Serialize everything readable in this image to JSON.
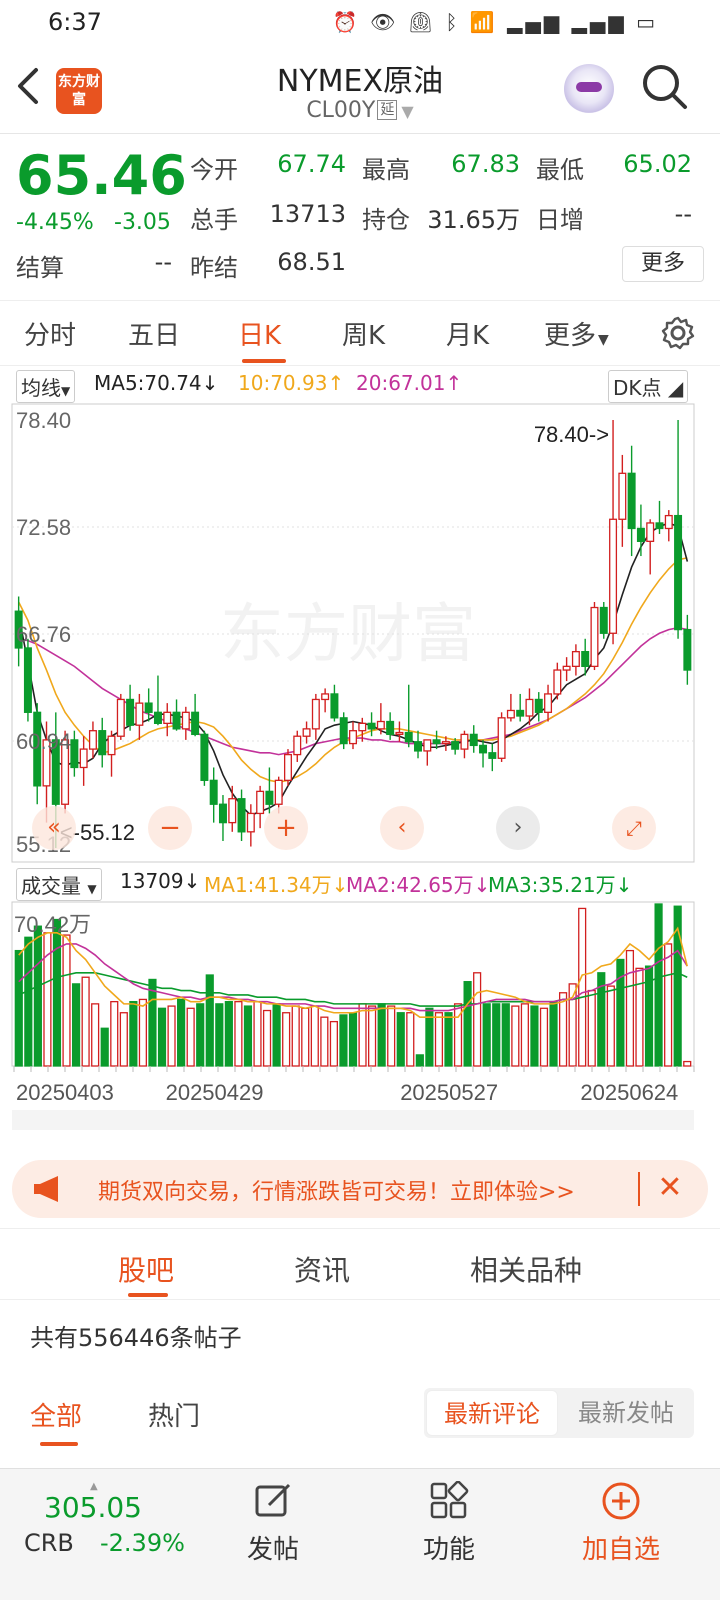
{
  "status_bar": {
    "time": "6:37",
    "icons": [
      "alarm-icon",
      "eye-icon",
      "clock-icon",
      "bluetooth-icon",
      "wifi-icon",
      "signal-4g-icon",
      "signal-4g-icon",
      "battery-icon"
    ]
  },
  "header": {
    "logo_text": "东方财富",
    "title": "NYMEX原油",
    "code": "CL00Y",
    "code_tag": "延"
  },
  "quote": {
    "price": "65.46",
    "change_pct": "-4.45%",
    "change": "-3.05",
    "open_label": "今开",
    "open": "67.74",
    "high_label": "最高",
    "high": "67.83",
    "low_label": "最低",
    "low": "65.02",
    "volume_label": "总手",
    "volume": "13713",
    "oi_label": "持仓",
    "oi": "31.65万",
    "daily_inc_label": "日增",
    "daily_inc": "--",
    "settle_label": "结算",
    "settle": "--",
    "prev_settle_label": "昨结",
    "prev_settle": "68.51",
    "more_label": "更多"
  },
  "period_tabs": [
    "分时",
    "五日",
    "日K",
    "周K",
    "月K",
    "更多"
  ],
  "active_period_tab": 2,
  "chart_legend": {
    "selector": "均线",
    "ma5": "MA5:70.74↓",
    "ma10": "10:70.93↑",
    "ma20": "20:67.01↑",
    "dk_label": "DK点",
    "vol_selector": "成交量",
    "vol_value": "13709↓",
    "vol_ma1": "MA1:41.34万↓",
    "vol_ma2": "MA2:42.65万↓",
    "vol_ma3": "MA3:35.21万↓"
  },
  "chart_data": [
    {
      "type": "candlestick",
      "y_ticks": [
        "78.40",
        "72.58",
        "66.76",
        "60.94",
        "55.12"
      ],
      "ylim": [
        55.12,
        78.4
      ],
      "annotations": {
        "high_label": "78.40->",
        "low_label": "<-55.12"
      },
      "watermark": "东方财富",
      "x_ticks": [
        "20250403",
        "20250429",
        "20250527",
        "20250624"
      ],
      "candles": [
        [
          68.0,
          68.8,
          65.0,
          66.0
        ],
        [
          66.0,
          66.5,
          62.0,
          62.5
        ],
        [
          62.5,
          63.0,
          57.5,
          58.5
        ],
        [
          58.5,
          62.0,
          56.5,
          61.0
        ],
        [
          61.0,
          62.5,
          55.12,
          57.5
        ],
        [
          57.5,
          61.5,
          57.0,
          61.0
        ],
        [
          61.0,
          61.5,
          59.0,
          59.5
        ],
        [
          59.5,
          61.2,
          58.5,
          60.5
        ],
        [
          60.5,
          62.0,
          60.0,
          61.5
        ],
        [
          61.5,
          62.2,
          59.5,
          60.2
        ],
        [
          60.2,
          61.5,
          59.0,
          61.2
        ],
        [
          61.2,
          63.5,
          61.0,
          63.2
        ],
        [
          63.2,
          64.0,
          61.5,
          61.8
        ],
        [
          61.8,
          63.5,
          61.0,
          63.0
        ],
        [
          63.0,
          63.8,
          62.0,
          62.5
        ],
        [
          62.5,
          64.5,
          61.8,
          61.9
        ],
        [
          61.9,
          63.0,
          61.2,
          62.5
        ],
        [
          62.5,
          63.2,
          61.5,
          61.6
        ],
        [
          61.6,
          62.8,
          61.0,
          62.5
        ],
        [
          62.5,
          63.5,
          61.2,
          61.3
        ],
        [
          61.3,
          61.5,
          58.5,
          58.8
        ],
        [
          58.8,
          59.5,
          56.5,
          57.5
        ],
        [
          57.5,
          58.0,
          55.5,
          56.5
        ],
        [
          56.5,
          58.5,
          56.0,
          57.8
        ],
        [
          57.8,
          58.3,
          55.5,
          56.0
        ],
        [
          56.0,
          57.5,
          55.2,
          57.0
        ],
        [
          57.0,
          58.5,
          56.2,
          58.2
        ],
        [
          58.2,
          59.5,
          57.0,
          57.5
        ],
        [
          57.5,
          59.0,
          57.0,
          58.8
        ],
        [
          58.8,
          60.5,
          58.5,
          60.2
        ],
        [
          60.2,
          61.5,
          59.8,
          61.2
        ],
        [
          61.2,
          62.0,
          60.8,
          61.6
        ],
        [
          61.6,
          63.5,
          61.0,
          63.2
        ],
        [
          63.2,
          63.8,
          62.5,
          63.5
        ],
        [
          63.5,
          64.0,
          62.0,
          62.2
        ],
        [
          62.2,
          62.5,
          60.5,
          60.8
        ],
        [
          60.8,
          62.0,
          60.5,
          61.5
        ],
        [
          61.5,
          62.2,
          60.9,
          61.9
        ],
        [
          61.9,
          62.5,
          61.2,
          61.6
        ],
        [
          61.6,
          63.0,
          61.3,
          62.0
        ],
        [
          62.0,
          62.5,
          61.0,
          61.3
        ],
        [
          61.3,
          62.0,
          60.9,
          61.4
        ],
        [
          61.4,
          64.0,
          60.6,
          60.9
        ],
        [
          60.9,
          61.5,
          60.0,
          60.4
        ],
        [
          60.4,
          61.0,
          59.6,
          61.0
        ],
        [
          61.0,
          61.5,
          60.5,
          60.8
        ],
        [
          60.8,
          61.2,
          60.4,
          60.9
        ],
        [
          60.9,
          61.1,
          60.2,
          60.5
        ],
        [
          60.5,
          61.5,
          60.0,
          61.3
        ],
        [
          61.3,
          61.8,
          60.3,
          60.7
        ],
        [
          60.7,
          61.0,
          59.5,
          60.3
        ],
        [
          60.3,
          60.8,
          59.3,
          60.0
        ],
        [
          60.0,
          62.5,
          59.8,
          62.2
        ],
        [
          62.2,
          63.5,
          62.0,
          62.6
        ],
        [
          62.6,
          63.5,
          62.0,
          62.3
        ],
        [
          62.3,
          63.8,
          61.8,
          63.2
        ],
        [
          63.2,
          63.6,
          62.0,
          62.5
        ],
        [
          62.5,
          64.0,
          62.0,
          63.5
        ],
        [
          63.5,
          65.2,
          63.2,
          64.8
        ],
        [
          64.8,
          65.5,
          64.2,
          65.0
        ],
        [
          65.0,
          66.2,
          64.5,
          65.8
        ],
        [
          65.8,
          66.5,
          64.5,
          65.0
        ],
        [
          65.0,
          68.5,
          64.8,
          68.2
        ],
        [
          68.2,
          68.5,
          66.5,
          66.8
        ],
        [
          66.8,
          78.4,
          66.2,
          73.0
        ],
        [
          73.0,
          76.5,
          71.5,
          75.5
        ],
        [
          75.5,
          77.0,
          71.0,
          72.5
        ],
        [
          72.5,
          73.8,
          71.0,
          71.8
        ],
        [
          71.8,
          73.0,
          70.0,
          72.8
        ],
        [
          72.8,
          74.0,
          72.2,
          72.5
        ],
        [
          72.5,
          73.5,
          71.8,
          73.2
        ],
        [
          73.2,
          78.4,
          66.5,
          67.0
        ],
        [
          67.0,
          67.8,
          64.0,
          64.8
        ]
      ],
      "ma_lines": {
        "MA5_color": "#222222",
        "MA10_color": "#f0a81c",
        "MA20_color": "#c2329a",
        "MA5": [
          67.8,
          65.2,
          62.5,
          61.0,
          59.8,
          59.6,
          59.8,
          59.7,
          60.0,
          60.8,
          61.2,
          61.5,
          61.8,
          61.9,
          62.1,
          62.4,
          62.4,
          62.3,
          62.2,
          62.0,
          61.4,
          60.4,
          59.1,
          58.1,
          57.4,
          56.9,
          57.1,
          57.3,
          57.6,
          58.5,
          59.3,
          60.1,
          60.8,
          61.6,
          61.8,
          61.9,
          62.0,
          61.9,
          61.8,
          61.5,
          61.3,
          61.2,
          61.0,
          60.8,
          60.6,
          60.6,
          60.7,
          60.8,
          60.9,
          61.0,
          60.9,
          60.8,
          61.0,
          61.3,
          61.6,
          62.0,
          62.5,
          62.8,
          63.4,
          64.0,
          64.3,
          64.6,
          65.4,
          66.0,
          67.3,
          68.9,
          70.4,
          71.5,
          72.3,
          72.6,
          72.8,
          72.6,
          70.7
        ],
        "MA10": [
          68.5,
          67.5,
          66.0,
          64.8,
          63.5,
          62.5,
          61.8,
          61.2,
          60.7,
          60.3,
          60.4,
          60.6,
          60.8,
          61.1,
          61.4,
          61.6,
          61.7,
          61.8,
          61.9,
          62.0,
          61.9,
          61.7,
          61.2,
          60.6,
          59.9,
          59.4,
          59.0,
          58.8,
          58.7,
          58.8,
          59.0,
          59.3,
          59.7,
          60.2,
          60.6,
          60.9,
          61.1,
          61.3,
          61.5,
          61.6,
          61.6,
          61.6,
          61.5,
          61.4,
          61.3,
          61.2,
          61.1,
          61.0,
          61.0,
          61.0,
          61.0,
          61.0,
          61.1,
          61.2,
          61.4,
          61.6,
          61.8,
          62.1,
          62.4,
          62.7,
          63.1,
          63.5,
          64.0,
          64.6,
          65.4,
          66.3,
          67.3,
          68.2,
          69.0,
          69.7,
          70.3,
          70.8,
          70.9
        ],
        "MA20": [
          66.5,
          66.4,
          66.2,
          65.9,
          65.6,
          65.3,
          65.0,
          64.6,
          64.2,
          63.8,
          63.5,
          63.2,
          62.9,
          62.6,
          62.4,
          62.2,
          62.0,
          61.8,
          61.6,
          61.4,
          61.2,
          61.0,
          60.8,
          60.6,
          60.5,
          60.4,
          60.3,
          60.3,
          60.2,
          60.3,
          60.4,
          60.6,
          60.8,
          60.9,
          61.0,
          61.1,
          61.1,
          61.1,
          61.0,
          61.0,
          60.9,
          60.9,
          60.8,
          60.8,
          60.8,
          60.8,
          60.8,
          60.9,
          60.9,
          61.0,
          61.0,
          61.1,
          61.2,
          61.3,
          61.5,
          61.7,
          61.9,
          62.1,
          62.4,
          62.7,
          63.0,
          63.3,
          63.7,
          64.1,
          64.6,
          65.1,
          65.6,
          66.1,
          66.5,
          66.8,
          67.0,
          67.1,
          67.0
        ]
      }
    },
    {
      "type": "bar",
      "y_ticks": [
        "70.42万"
      ],
      "ylim": [
        0,
        73
      ],
      "values": [
        52,
        58,
        63,
        60,
        66,
        59,
        37,
        40,
        28,
        17,
        29,
        24,
        29,
        30,
        39,
        26,
        27,
        30,
        26,
        28,
        41,
        28,
        29,
        29,
        27,
        29,
        25,
        28,
        24,
        27,
        26,
        27,
        22,
        20,
        23,
        24,
        28,
        27,
        28,
        27,
        24,
        24,
        5,
        26,
        24,
        24,
        28,
        38,
        42,
        28,
        28,
        28,
        27,
        28,
        27,
        26,
        29,
        33,
        37,
        71,
        34,
        42,
        36,
        48,
        52,
        44,
        45,
        73,
        55,
        72,
        2
      ],
      "ma_lines": {
        "MA1_color": "#f0a81c",
        "MA2_color": "#c2329a",
        "MA3_color": "#0a9b2c",
        "MA1": [
          50,
          55,
          58,
          60,
          60,
          58,
          52,
          48,
          42,
          36,
          32,
          28,
          28,
          27,
          30,
          30,
          30,
          31,
          29,
          29,
          31,
          31,
          30,
          30,
          29,
          29,
          28,
          28,
          27,
          27,
          26,
          27,
          25,
          24,
          24,
          24,
          25,
          25,
          26,
          26,
          26,
          25,
          22,
          22,
          22,
          22,
          22,
          28,
          33,
          34,
          33,
          32,
          31,
          29,
          28,
          28,
          28,
          29,
          31,
          41,
          42,
          45,
          46,
          50,
          55,
          52,
          48,
          53,
          56,
          62,
          45
        ],
        "MA2": [
          38,
          42,
          46,
          50,
          53,
          55,
          55,
          53,
          50,
          46,
          43,
          40,
          37,
          35,
          34,
          33,
          32,
          31,
          31,
          30,
          31,
          31,
          31,
          30,
          30,
          29,
          29,
          28,
          28,
          28,
          28,
          27,
          27,
          26,
          26,
          26,
          26,
          26,
          26,
          26,
          26,
          26,
          25,
          25,
          25,
          25,
          26,
          27,
          28,
          29,
          30,
          30,
          30,
          30,
          29,
          29,
          29,
          30,
          30,
          33,
          34,
          36,
          37,
          40,
          42,
          43,
          44,
          47,
          49,
          52,
          45
        ],
        "MA3": [
          32,
          34,
          36,
          38,
          40,
          41,
          42,
          42,
          42,
          41,
          40,
          39,
          38,
          37,
          36,
          35,
          35,
          34,
          34,
          33,
          33,
          33,
          32,
          32,
          32,
          31,
          31,
          31,
          30,
          30,
          30,
          29,
          29,
          28,
          28,
          28,
          28,
          28,
          28,
          28,
          28,
          28,
          27,
          27,
          27,
          27,
          27,
          28,
          28,
          29,
          29,
          29,
          29,
          29,
          29,
          29,
          29,
          30,
          30,
          31,
          32,
          33,
          34,
          35,
          36,
          37,
          38,
          40,
          41,
          42,
          40
        ]
      }
    }
  ],
  "chart_controls": [
    "rewind-icon",
    "zoom-out-icon",
    "zoom-in-icon",
    "prev-icon",
    "next-icon",
    "fullscreen-icon"
  ],
  "banner": {
    "text": "期货双向交易，行情涨跌皆可交易！立即体验>>"
  },
  "section_tabs": [
    "股吧",
    "资讯",
    "相关品种"
  ],
  "active_section_tab": 0,
  "posts_count": "共有556446条帖子",
  "filter": {
    "tabs": [
      "全部",
      "热门"
    ],
    "active": 0,
    "sort_active": "最新评论",
    "sort_inactive": "最新发帖"
  },
  "bottom_bar": {
    "crb_value": "305.05",
    "crb_label": "CRB",
    "crb_change": "-2.39%",
    "post_label": "发帖",
    "func_label": "功能",
    "add_label": "加自选"
  },
  "colors": {
    "accent": "#e8531f",
    "up": "#d21f1f",
    "down": "#0a9b2c"
  }
}
